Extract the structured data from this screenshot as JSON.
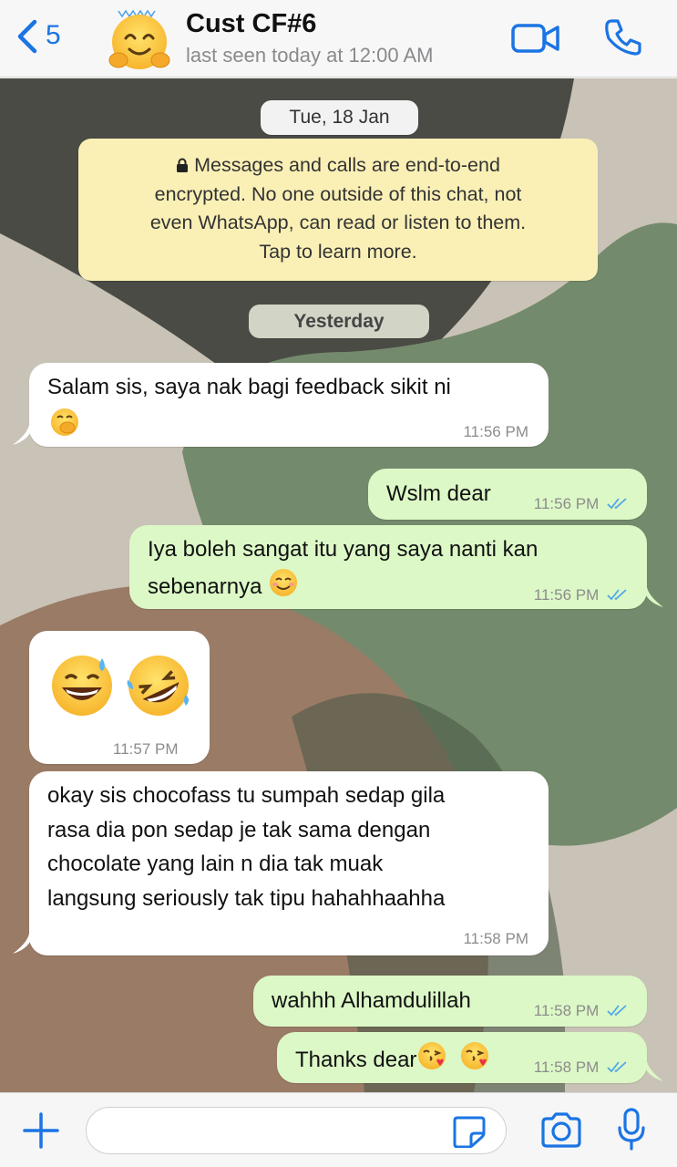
{
  "header": {
    "back_count": "5",
    "contact_name": "Cust CF#6",
    "last_seen": "last seen today at 12:00 AM",
    "icons": {
      "back": "chevron-left-icon",
      "video": "video-call-icon",
      "call": "phone-icon",
      "avatar": "hugging-face-emoji"
    }
  },
  "chat": {
    "date_label": "Tue, 18 Jan",
    "encryption_notice": "Messages and calls are end-to-end encrypted. No one outside of this chat, not even WhatsApp, can read or listen to them. Tap to learn more.",
    "encryption_lines": [
      "Messages and calls are end-to-end",
      "encrypted. No one outside of this chat, not",
      "even WhatsApp, can read or listen to them.",
      "Tap to learn more."
    ],
    "yesterday_label": "Yesterday",
    "messages": [
      {
        "direction": "in",
        "lines": [
          "Salam sis, saya nak bagi feedback sikit ni"
        ],
        "emoji": "face-with-hand-over-mouth",
        "time": "11:56 PM"
      },
      {
        "direction": "out",
        "lines": [
          "Wslm dear"
        ],
        "time": "11:56 PM",
        "status": "read"
      },
      {
        "direction": "out",
        "lines": [
          "Iya boleh sangat itu yang saya nanti kan",
          "sebenarnya"
        ],
        "emoji": "smiling-face-with-smiling-eyes",
        "time": "11:56 PM",
        "status": "read"
      },
      {
        "direction": "in",
        "emojis": [
          "grinning-face-with-sweat",
          "rolling-on-the-floor-laughing"
        ],
        "time": "11:57 PM"
      },
      {
        "direction": "in",
        "lines": [
          "okay sis chocofass tu sumpah sedap gila",
          "rasa dia pon sedap je tak sama dengan",
          "chocolate yang lain n dia tak muak",
          "langsung seriously tak tipu hahahhaahha"
        ],
        "time": "11:58 PM"
      },
      {
        "direction": "out",
        "lines": [
          "wahhh Alhamdulillah"
        ],
        "time": "11:58 PM",
        "status": "read"
      },
      {
        "direction": "out",
        "lines": [
          "Thanks dear"
        ],
        "emojis": [
          "face-blowing-a-kiss",
          "face-blowing-a-kiss"
        ],
        "time": "11:58 PM",
        "status": "read"
      }
    ]
  },
  "input": {
    "placeholder": "",
    "icons": {
      "plus": "plus-icon",
      "sticker": "sticker-icon",
      "camera": "camera-icon",
      "mic": "microphone-icon"
    }
  },
  "colors": {
    "accent": "#1b74e4",
    "incoming_bubble": "#ffffff",
    "outgoing_bubble": "#dcf8c6",
    "notice_bg": "#faf0b6",
    "read_ticks": "#4fa8e8"
  }
}
